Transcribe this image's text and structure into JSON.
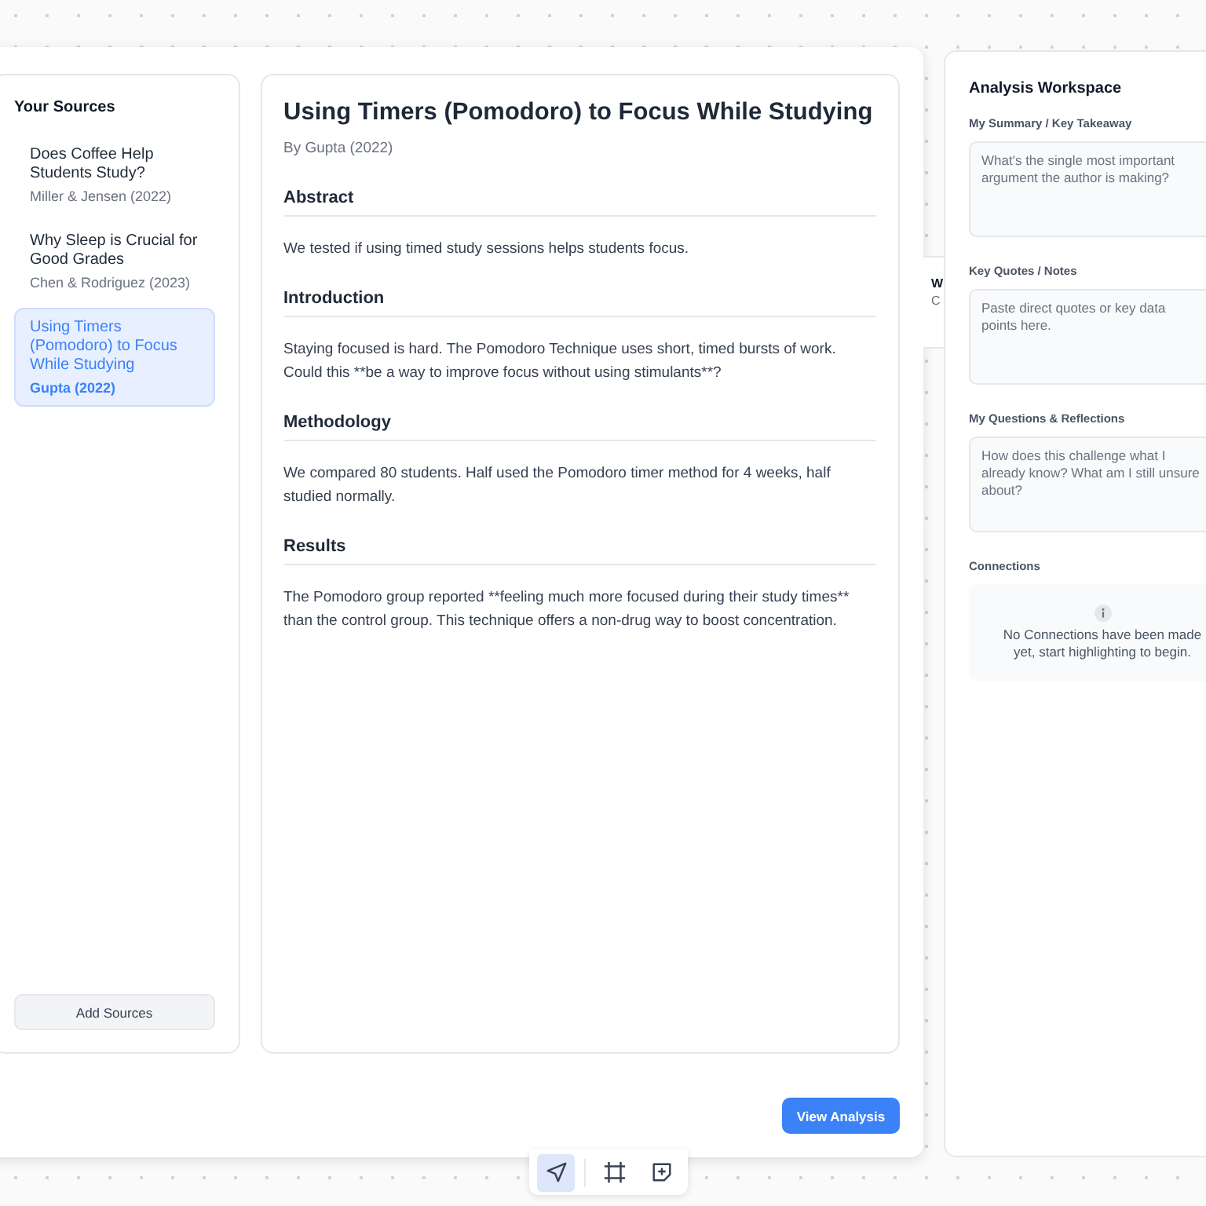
{
  "sources": {
    "title": "Your Sources",
    "items": [
      {
        "title": "Does Coffee Help Students Study?",
        "author": "Miller & Jensen (2022)",
        "selected": false
      },
      {
        "title": "Why Sleep is Crucial for Good Grades",
        "author": "Chen & Rodriguez (2023)",
        "selected": false
      },
      {
        "title": "Using Timers (Pomodoro) to Focus While Studying",
        "author": "Gupta (2022)",
        "selected": true
      }
    ],
    "add_button": "Add Sources"
  },
  "article": {
    "title": "Using Timers (Pomodoro) to Focus While Studying",
    "byline": "By Gupta (2022)",
    "sections": [
      {
        "heading": "Abstract",
        "body": "We tested if using timed study sessions helps students focus."
      },
      {
        "heading": "Introduction",
        "body": "Staying focused is hard. The Pomodoro Technique uses short, timed bursts of work. Could this **be a way to improve focus without using stimulants**?"
      },
      {
        "heading": "Methodology",
        "body": "We compared 80 students. Half used the Pomodoro timer method for 4 weeks, half studied normally."
      },
      {
        "heading": "Results",
        "body": "The Pomodoro group reported **feeling much more focused during their study times** than the control group. This technique offers a non-drug way to boost concentration."
      }
    ]
  },
  "view_button": "View Analysis",
  "hidden_card": {
    "line_1": "W",
    "line_2": "C"
  },
  "workspace": {
    "title": "Analysis Workspace",
    "fields": [
      {
        "label": "My Summary / Key Takeaway",
        "placeholder": "What's the single most important argument the author is making?"
      },
      {
        "label": "Key Quotes / Notes",
        "placeholder": "Paste direct quotes or key data points here."
      },
      {
        "label": "My Questions & Reflections",
        "placeholder": "How does this challenge what I already know? What am I still unsure about?"
      }
    ],
    "connections_label": "Connections",
    "connections_empty": "No Connections have been made yet, start highlighting to begin."
  },
  "toolbar": {
    "tools": [
      {
        "kind": "pointer",
        "selected": true
      },
      {
        "kind": "frame",
        "selected": false
      },
      {
        "kind": "note",
        "selected": false
      }
    ]
  }
}
